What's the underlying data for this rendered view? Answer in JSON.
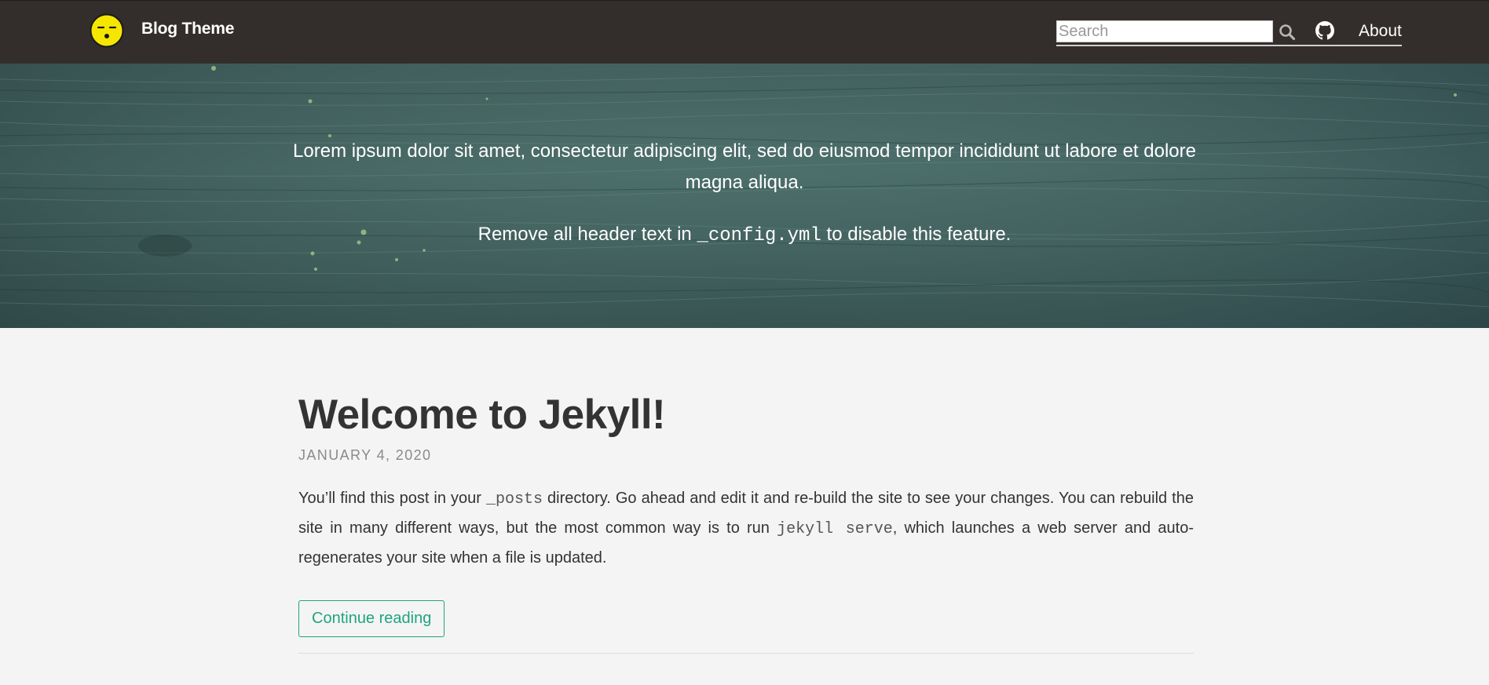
{
  "navbar": {
    "brand": "Blog Theme",
    "logo_icon": "sleepy-face-icon",
    "search_placeholder": "Search",
    "search_icon": "search-icon",
    "github_icon": "github-icon",
    "about_label": "About"
  },
  "hero": {
    "line1": "Lorem ipsum dolor sit amet, consectetur adipiscing elit, sed do eiusmod tempor incididunt ut labore et dolore magna aliqua.",
    "line2_before": "Remove all header text in ",
    "line2_code": "_config.yml",
    "line2_after": " to disable this feature."
  },
  "post": {
    "title": "Welcome to Jekyll!",
    "date": "JANUARY 4, 2020",
    "excerpt_part1": "You’ll find this post in your ",
    "excerpt_code1": "_posts",
    "excerpt_part2": " directory. Go ahead and edit it and re-build the site to see your changes. You can rebuild the site in many different ways, but the most common way is to run ",
    "excerpt_code2": "jekyll serve",
    "excerpt_part3": ", which launches a web server and auto-regenerates your site when a file is updated.",
    "continue_label": "Continue reading"
  },
  "colors": {
    "navbar_bg": "#332e2b",
    "accent": "#1fa57e",
    "page_bg": "#f4f4f4",
    "logo_yellow": "#f5e600"
  }
}
